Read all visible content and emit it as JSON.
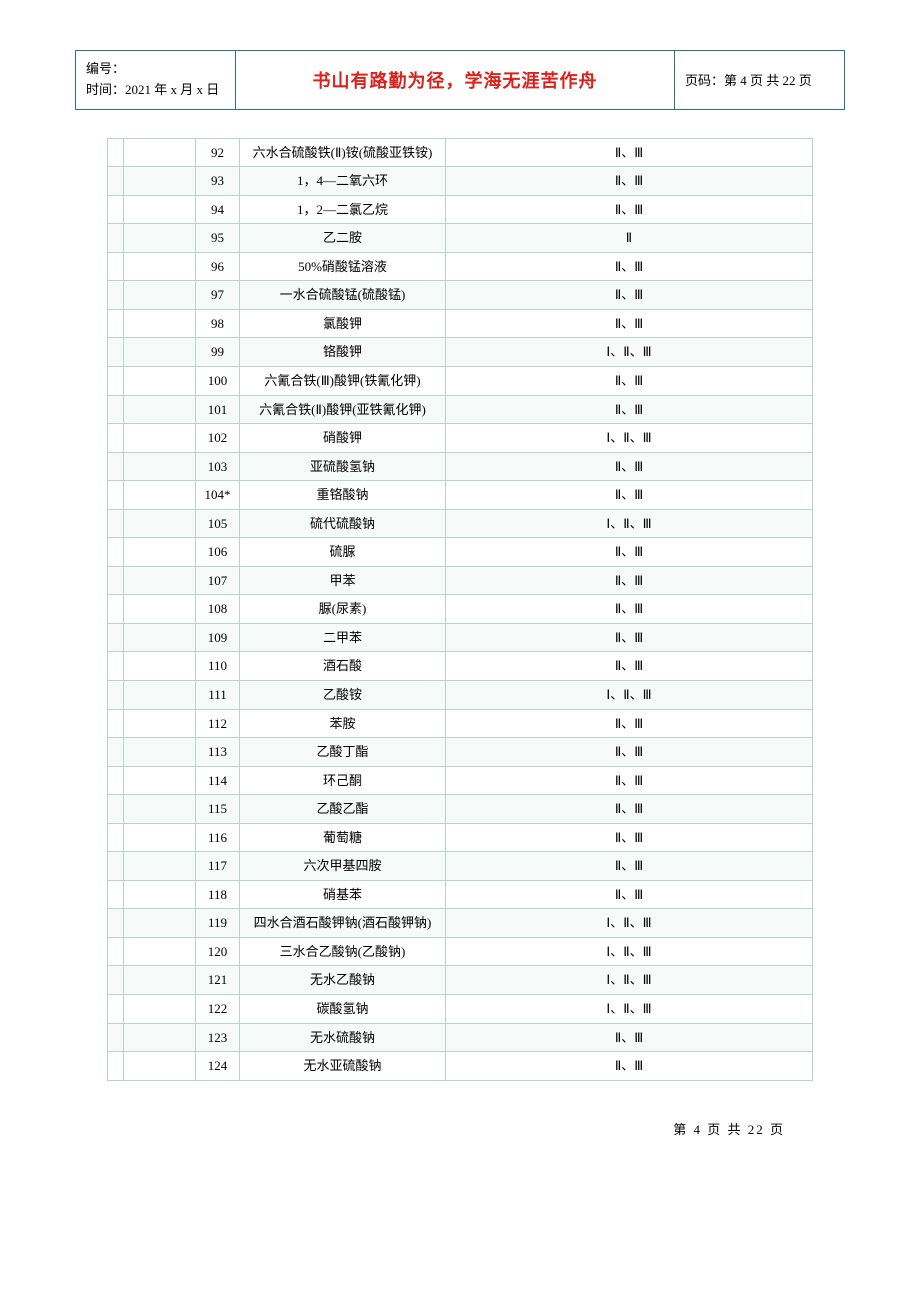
{
  "header": {
    "bianhao_label": "编号：",
    "time_label": "时间：",
    "time_value": "2021 年 x 月 x 日",
    "motto": "书山有路勤为径，学海无涯苦作舟",
    "page_label": "页码：",
    "page_value": "第 4 页  共 22 页"
  },
  "footer": {
    "text": "第 4 页 共 22 页"
  },
  "rows": [
    {
      "idx": "92",
      "name": "六水合硫酸铁(Ⅱ)铵(硫酸亚铁铵)",
      "cat": "Ⅱ、Ⅲ"
    },
    {
      "idx": "93",
      "name": "1，4—二氧六环",
      "cat": "Ⅱ、Ⅲ"
    },
    {
      "idx": "94",
      "name": "1，2—二氯乙烷",
      "cat": "Ⅱ、Ⅲ"
    },
    {
      "idx": "95",
      "name": "乙二胺",
      "cat": "Ⅱ"
    },
    {
      "idx": "96",
      "name": "50%硝酸锰溶液",
      "cat": "Ⅱ、Ⅲ"
    },
    {
      "idx": "97",
      "name": "一水合硫酸锰(硫酸锰)",
      "cat": "Ⅱ、Ⅲ"
    },
    {
      "idx": "98",
      "name": "氯酸钾",
      "cat": "Ⅱ、Ⅲ"
    },
    {
      "idx": "99",
      "name": "铬酸钾",
      "cat": "Ⅰ、Ⅱ、Ⅲ"
    },
    {
      "idx": "100",
      "name": "六氰合铁(Ⅲ)酸钾(铁氰化钾)",
      "cat": "Ⅱ、Ⅲ"
    },
    {
      "idx": "101",
      "name": "六氰合铁(Ⅱ)酸钾(亚铁氰化钾)",
      "cat": "Ⅱ、Ⅲ"
    },
    {
      "idx": "102",
      "name": "硝酸钾",
      "cat": "Ⅰ、Ⅱ、Ⅲ"
    },
    {
      "idx": "103",
      "name": "亚硫酸氢钠",
      "cat": "Ⅱ、Ⅲ"
    },
    {
      "idx": "104*",
      "name": "重铬酸钠",
      "cat": "Ⅱ、Ⅲ"
    },
    {
      "idx": "105",
      "name": "硫代硫酸钠",
      "cat": "Ⅰ、Ⅱ、Ⅲ"
    },
    {
      "idx": "106",
      "name": "硫脲",
      "cat": "Ⅱ、Ⅲ"
    },
    {
      "idx": "107",
      "name": "甲苯",
      "cat": "Ⅱ、Ⅲ"
    },
    {
      "idx": "108",
      "name": "脲(尿素)",
      "cat": "Ⅱ、Ⅲ"
    },
    {
      "idx": "109",
      "name": "二甲苯",
      "cat": "Ⅱ、Ⅲ"
    },
    {
      "idx": "110",
      "name": "酒石酸",
      "cat": "Ⅱ、Ⅲ"
    },
    {
      "idx": "111",
      "name": "乙酸铵",
      "cat": "Ⅰ、Ⅱ、Ⅲ"
    },
    {
      "idx": "112",
      "name": "苯胺",
      "cat": "Ⅱ、Ⅲ"
    },
    {
      "idx": "113",
      "name": "乙酸丁酯",
      "cat": "Ⅱ、Ⅲ"
    },
    {
      "idx": "114",
      "name": "环己酮",
      "cat": "Ⅱ、Ⅲ"
    },
    {
      "idx": "115",
      "name": "乙酸乙酯",
      "cat": "Ⅱ、Ⅲ"
    },
    {
      "idx": "116",
      "name": "葡萄糖",
      "cat": "Ⅱ、Ⅲ"
    },
    {
      "idx": "117",
      "name": "六次甲基四胺",
      "cat": "Ⅱ、Ⅲ"
    },
    {
      "idx": "118",
      "name": "硝基苯",
      "cat": "Ⅱ、Ⅲ"
    },
    {
      "idx": "119",
      "name": "四水合酒石酸钾钠(酒石酸钾钠)",
      "cat": "Ⅰ、Ⅱ、Ⅲ"
    },
    {
      "idx": "120",
      "name": "三水合乙酸钠(乙酸钠)",
      "cat": "Ⅰ、Ⅱ、Ⅲ"
    },
    {
      "idx": "121",
      "name": "无水乙酸钠",
      "cat": "Ⅰ、Ⅱ、Ⅲ"
    },
    {
      "idx": "122",
      "name": "碳酸氢钠",
      "cat": "Ⅰ、Ⅱ、Ⅲ"
    },
    {
      "idx": "123",
      "name": "无水硫酸钠",
      "cat": "Ⅱ、Ⅲ"
    },
    {
      "idx": "124",
      "name": "无水亚硫酸钠",
      "cat": "Ⅱ、Ⅲ"
    }
  ]
}
